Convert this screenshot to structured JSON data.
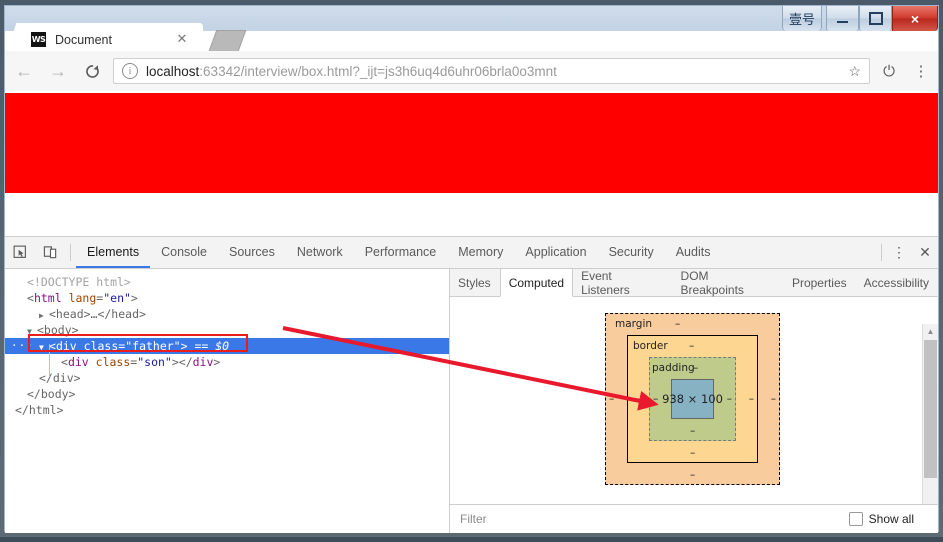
{
  "window": {
    "controls": {
      "label_button": "壹号",
      "minimize": "minimize-button",
      "maximize": "maximize-button",
      "close": "×"
    }
  },
  "browser": {
    "tab": {
      "favicon_text": "WS",
      "title": "Document",
      "close_label": "✕"
    },
    "toolbar": {
      "back": "←",
      "forward": "→",
      "reload": "C",
      "info_icon": "i",
      "url_host": "localhost",
      "url_rest": ":63342/interview/box.html?_ijt=js3h6uq4d6uhr06brla0o3mnt",
      "url_full": "localhost:63342/interview/box.html?_ijt=js3h6uq4d6uhr06brla0o3mnt",
      "star": "☆",
      "power": "⏻",
      "menu": "⋮"
    }
  },
  "page": {
    "father_color": "#ff0000"
  },
  "devtools": {
    "toolbar": {
      "inspect_icon": "inspect-element-icon",
      "device_icon": "device-toolbar-icon",
      "more": "⋮",
      "close": "✕"
    },
    "tabs": [
      {
        "label": "Elements",
        "active": true
      },
      {
        "label": "Console",
        "active": false
      },
      {
        "label": "Sources",
        "active": false
      },
      {
        "label": "Network",
        "active": false
      },
      {
        "label": "Performance",
        "active": false
      },
      {
        "label": "Memory",
        "active": false
      },
      {
        "label": "Application",
        "active": false
      },
      {
        "label": "Security",
        "active": false
      },
      {
        "label": "Audits",
        "active": false
      }
    ],
    "dom_tree": {
      "doctype": "<!DOCTYPE html>",
      "html_open_tag": "html",
      "html_attr_name": "lang",
      "html_attr_value": "\"en\"",
      "head_line": "<head>…</head>",
      "body_open": "<body>",
      "selected_tag": "div",
      "selected_attr_name": "class",
      "selected_attr_value": "\"father\"",
      "selected_suffix": "== $0",
      "child_line": "<div class=\"son\"></div>",
      "child_tag": "div",
      "child_attr_name": "class",
      "child_attr_value": "\"son\"",
      "div_close": "</div>",
      "body_close": "</body>",
      "html_close": "</html>",
      "expand_badge": "···"
    },
    "sidebar_tabs": [
      {
        "label": "Styles",
        "active": false
      },
      {
        "label": "Computed",
        "active": true
      },
      {
        "label": "Event Listeners",
        "active": false
      },
      {
        "label": "DOM Breakpoints",
        "active": false
      },
      {
        "label": "Properties",
        "active": false
      },
      {
        "label": "Accessibility",
        "active": false
      }
    ],
    "box_model": {
      "margin_label": "margin",
      "border_label": "border",
      "padding_label": "padding",
      "content_size": "938 × 100",
      "dash": "–",
      "colors": {
        "margin": "#f9cc9d",
        "border": "#fdd791",
        "padding": "#bfcb8b",
        "content": "#87b2c4"
      }
    },
    "filter": {
      "placeholder": "Filter",
      "value": "",
      "show_all_label": "Show all",
      "show_all_checked": false
    },
    "scrollbar": {
      "up_arrow": "▲"
    }
  },
  "annotation": {
    "arrow_color": "#e8192c",
    "highlight_color": "#ea1c1c"
  }
}
